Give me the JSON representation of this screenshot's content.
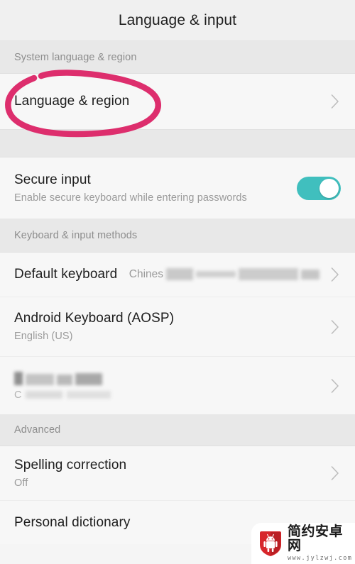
{
  "appbar": {
    "title": "Language & input"
  },
  "sections": {
    "system": {
      "label": "System language & region"
    },
    "keyboard": {
      "label": "Keyboard & input methods"
    },
    "advanced": {
      "label": "Advanced"
    }
  },
  "rows": {
    "language_region": {
      "title": "Language & region",
      "chevron": "chevron-right-icon"
    },
    "secure_input": {
      "title": "Secure input",
      "subtitle": "Enable secure keyboard while entering passwords",
      "toggle_state": "on",
      "toggle_color": "#40bfbe"
    },
    "default_keyboard": {
      "title": "Default keyboard",
      "value_visible_prefix": "Chines",
      "value_redacted": true,
      "chevron": "chevron-right-icon"
    },
    "android_keyboard": {
      "title": "Android Keyboard (AOSP)",
      "subtitle": "English (US)",
      "chevron": "chevron-right-icon"
    },
    "redacted_ime": {
      "title_redacted": true,
      "subtitle_visible_prefix": "C",
      "subtitle_redacted": true,
      "chevron": "chevron-right-icon"
    },
    "spelling_correction": {
      "title": "Spelling correction",
      "subtitle": "Off",
      "chevron": "chevron-right-icon"
    },
    "personal_dictionary": {
      "title": "Personal dictionary",
      "chevron": "chevron-right-icon"
    }
  },
  "annotation": {
    "kind": "hand-drawn-circle",
    "target": "Language & region",
    "color": "#dd2e6d"
  },
  "watermark": {
    "site_name": "简约安卓网",
    "url": "www.jylzwj.com",
    "logo": "android-shield-icon",
    "logo_color": "#d7262b"
  }
}
